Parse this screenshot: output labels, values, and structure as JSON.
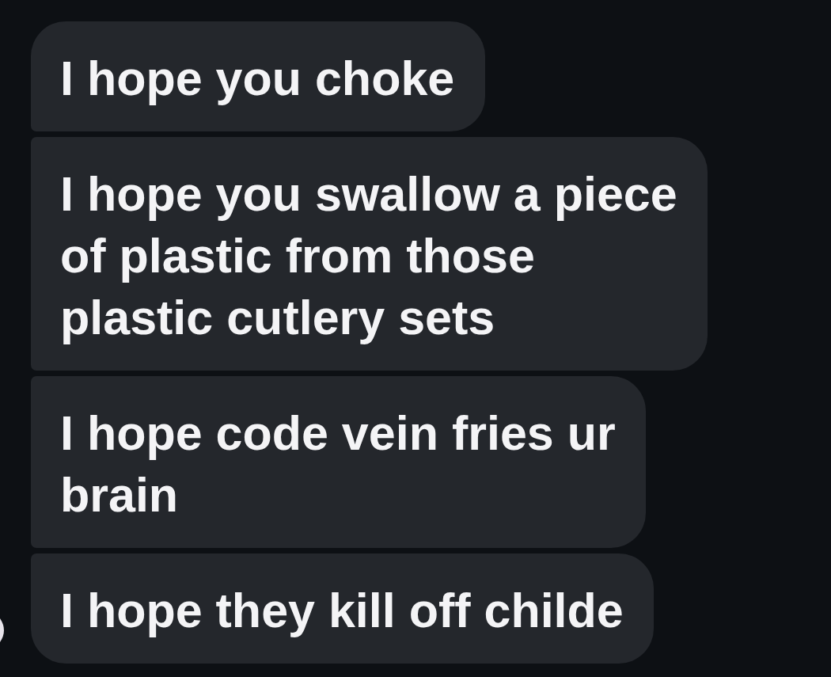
{
  "messages": [
    {
      "text": "I hope you choke"
    },
    {
      "text": "I hope you swallow a piece of plastic from those plastic cutlery sets"
    },
    {
      "text": "I hope code vein fries ur brain"
    },
    {
      "text": "I hope they kill off childe"
    }
  ]
}
